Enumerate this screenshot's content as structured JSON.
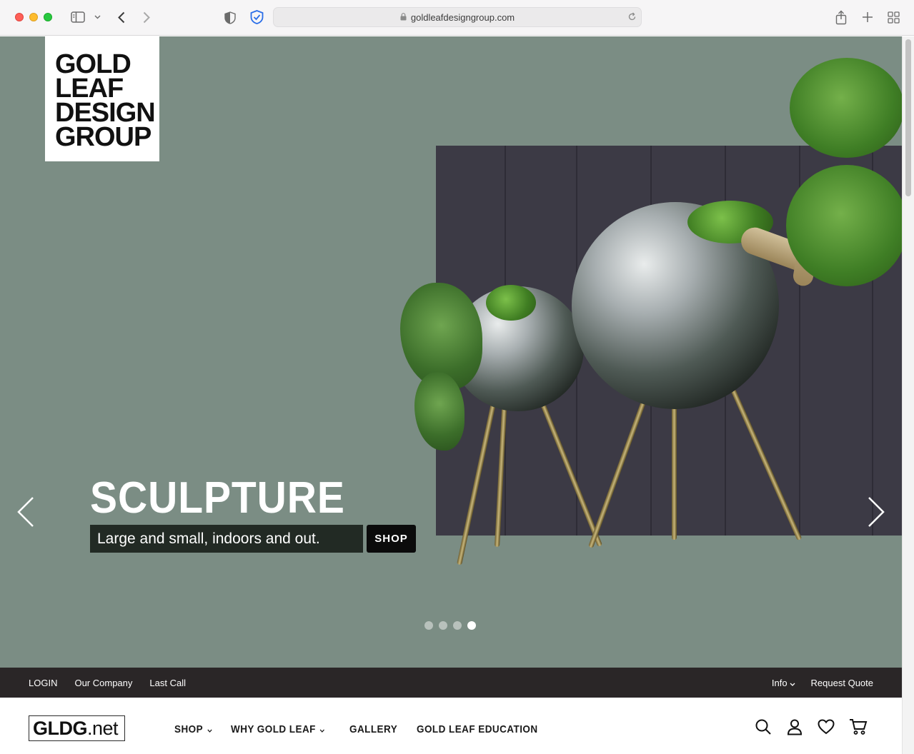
{
  "browser": {
    "url": "goldleafdesigngroup.com"
  },
  "logo": {
    "lines": [
      "GOLD",
      "LEAF",
      "DESIGN",
      "GROUP"
    ]
  },
  "hero": {
    "title": "SCULPTURE",
    "subtitle": "Large and small, indoors and out.",
    "shop_label": "SHOP",
    "background_color": "#7b8d84",
    "slides_total": 4,
    "active_slide": 4
  },
  "utility_bar": {
    "left_links": [
      "LOGIN",
      "Our Company",
      "Last Call"
    ],
    "info_label": "Info",
    "request_quote_label": "Request Quote"
  },
  "main_nav": {
    "logo_bold": "GLDG",
    "logo_rest": ".net",
    "items": [
      {
        "label": "SHOP",
        "has_dropdown": true
      },
      {
        "label": "WHY GOLD LEAF",
        "has_dropdown": true
      },
      {
        "label": "GALLERY",
        "has_dropdown": false
      },
      {
        "label": "GOLD LEAF EDUCATION",
        "has_dropdown": false
      }
    ],
    "icons": [
      "search-icon",
      "account-icon",
      "wishlist-heart-icon",
      "cart-icon"
    ]
  }
}
